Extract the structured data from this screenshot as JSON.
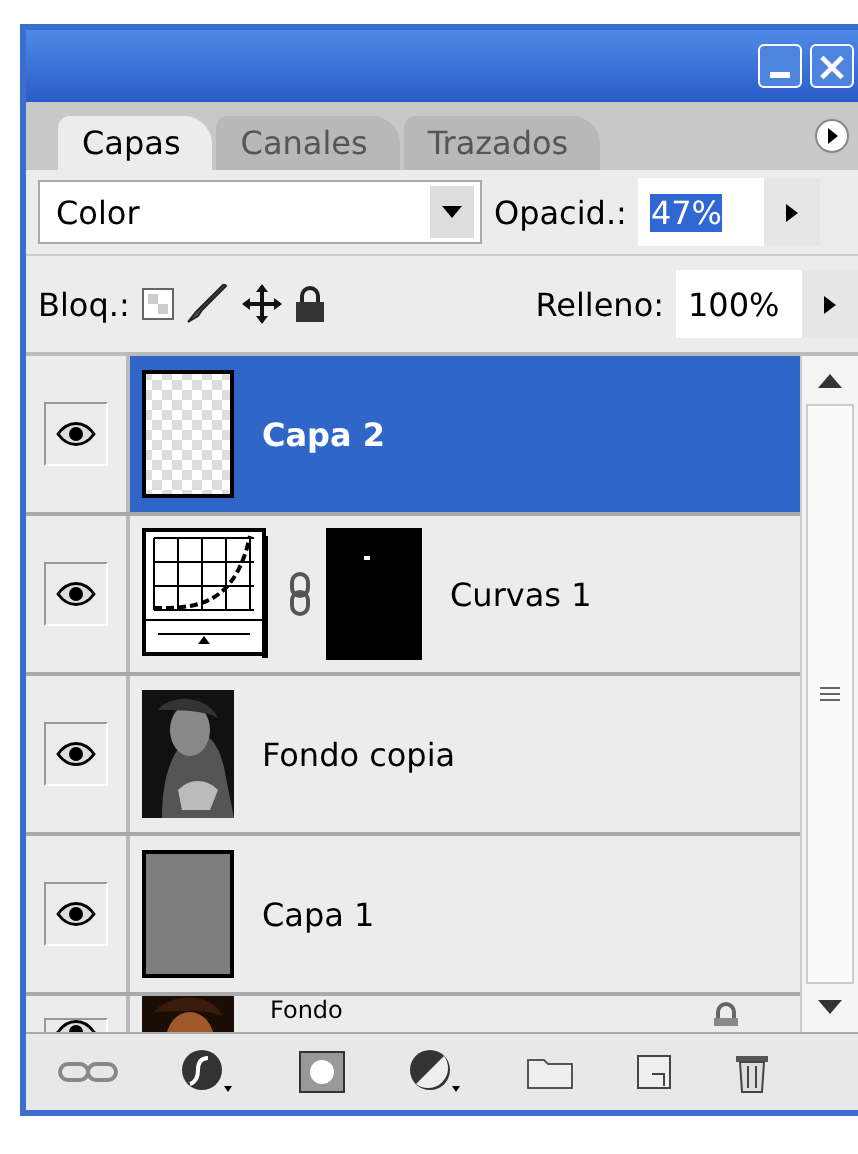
{
  "window": {
    "close": "×"
  },
  "tabs": [
    {
      "label": "Capas",
      "selected": true
    },
    {
      "label": "Canales",
      "selected": false
    },
    {
      "label": "Trazados",
      "selected": false
    }
  ],
  "blend_mode": {
    "value": "Color"
  },
  "opacity": {
    "label": "Opacid.:",
    "value": "47%",
    "highlighted": true
  },
  "lock": {
    "label": "Bloq.:"
  },
  "fill": {
    "label": "Relleno:",
    "value": "100%"
  },
  "layers": [
    {
      "name": "Capa 2",
      "selected": true,
      "visible": true,
      "kind": "transparent"
    },
    {
      "name": "Curvas 1",
      "selected": false,
      "visible": true,
      "kind": "adjustment"
    },
    {
      "name": "Fondo copia",
      "selected": false,
      "visible": true
    },
    {
      "name": "Capa 1",
      "selected": false,
      "visible": true,
      "kind": "gray"
    },
    {
      "name": "Fondo",
      "selected": false,
      "visible": true,
      "kind": "photo-color",
      "locked": true
    }
  ]
}
